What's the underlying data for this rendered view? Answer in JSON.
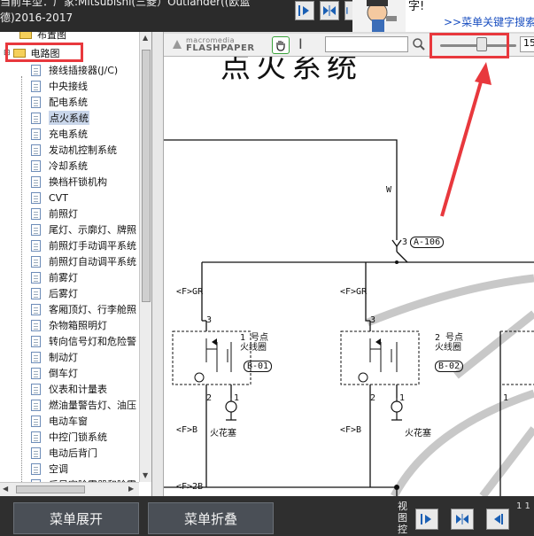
{
  "topbar": {
    "car_line1": "当前车型：厂家:Mitsubishi(三菱）Outlander((欧蓝",
    "car_line2": "德)2016-2017"
  },
  "ad": {
    "text": "字!",
    "link": ">>菜单关键字搜索"
  },
  "tree": {
    "root_item": "布置图",
    "folder": "电路图",
    "items": [
      "接线插接器(J/C)",
      "中央接线",
      "配电系统",
      "点火系统",
      "充电系统",
      "发动机控制系统",
      "冷却系统",
      "换档杆锁机构",
      "CVT",
      "前照灯",
      "尾灯、示廓灯、牌照",
      "前照灯手动调平系统",
      "前照灯自动调平系统",
      "前雾灯",
      "后雾灯",
      "客厢顶灯、行李舱照",
      "杂物箱照明灯",
      "转向信号灯和危险警",
      "制动灯",
      "倒车灯",
      "仪表和计量表",
      "燃油量警告灯、油压",
      "电动车窗",
      "中控门锁系统",
      "电动后背门",
      "空调",
      "后风窗除雾器和除雾"
    ],
    "selected_index": 3
  },
  "viewer": {
    "logo_top": "macromedia",
    "logo_bottom": "FLASHPAPER",
    "search_value": "",
    "zoom_value": "15",
    "zoom_level": 0.55,
    "page_title": "点火系统",
    "labels": {
      "w": "W",
      "connector_pin": "3",
      "connector_id": "A-106",
      "gr_left": "<F>GR",
      "gr_mid": "<F>GR",
      "coil1_line1": "1 号点",
      "coil1_line2": "火线圈",
      "coil1_id": "B-01",
      "coil2_line1": "2 号点",
      "coil2_line2": "火线圈",
      "coil2_id": "B-02",
      "pin3a": "3",
      "pin3b": "3",
      "pin2a": "2",
      "pin1a": "1",
      "pin2b": "2",
      "pin1b": "1",
      "pin1c": "1",
      "fb_left": "<F>B",
      "fb_mid": "<F>B",
      "spark1": "火花塞",
      "spark2": "火花塞",
      "f2b": "<F>2B"
    }
  },
  "bottom": {
    "expand_label": "菜单展开",
    "collapse_label": "菜单折叠",
    "view_label": "视图控",
    "page_num": "1 1"
  }
}
